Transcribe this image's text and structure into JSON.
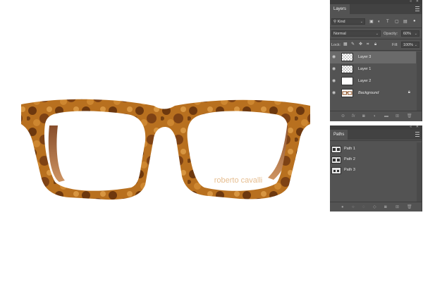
{
  "canvas": {
    "brand_text": "roberto cavalli",
    "frame_color": "#a05a1e"
  },
  "layers_panel": {
    "tab": "Layers",
    "filter_kind": "Kind",
    "blend_mode": "Normal",
    "opacity_label": "Opacity:",
    "opacity_value": "60%",
    "lock_label": "Lock:",
    "fill_label": "Fill:",
    "fill_value": "100%",
    "layers": [
      {
        "name": "Layer 3",
        "thumb": "checker",
        "selected": true
      },
      {
        "name": "Layer 1",
        "thumb": "checker",
        "selected": false
      },
      {
        "name": "Layer 2",
        "thumb": "white",
        "selected": false
      },
      {
        "name": "Background",
        "thumb": "glasses",
        "selected": false,
        "locked": true
      }
    ],
    "bottom_icons": [
      "link-icon",
      "fx-icon",
      "mask-icon",
      "adjustment-icon",
      "group-icon",
      "new-layer-icon",
      "trash-icon"
    ]
  },
  "paths_panel": {
    "tab": "Paths",
    "paths": [
      {
        "name": "Path 1"
      },
      {
        "name": "Path 2"
      },
      {
        "name": "Path 3"
      }
    ]
  }
}
